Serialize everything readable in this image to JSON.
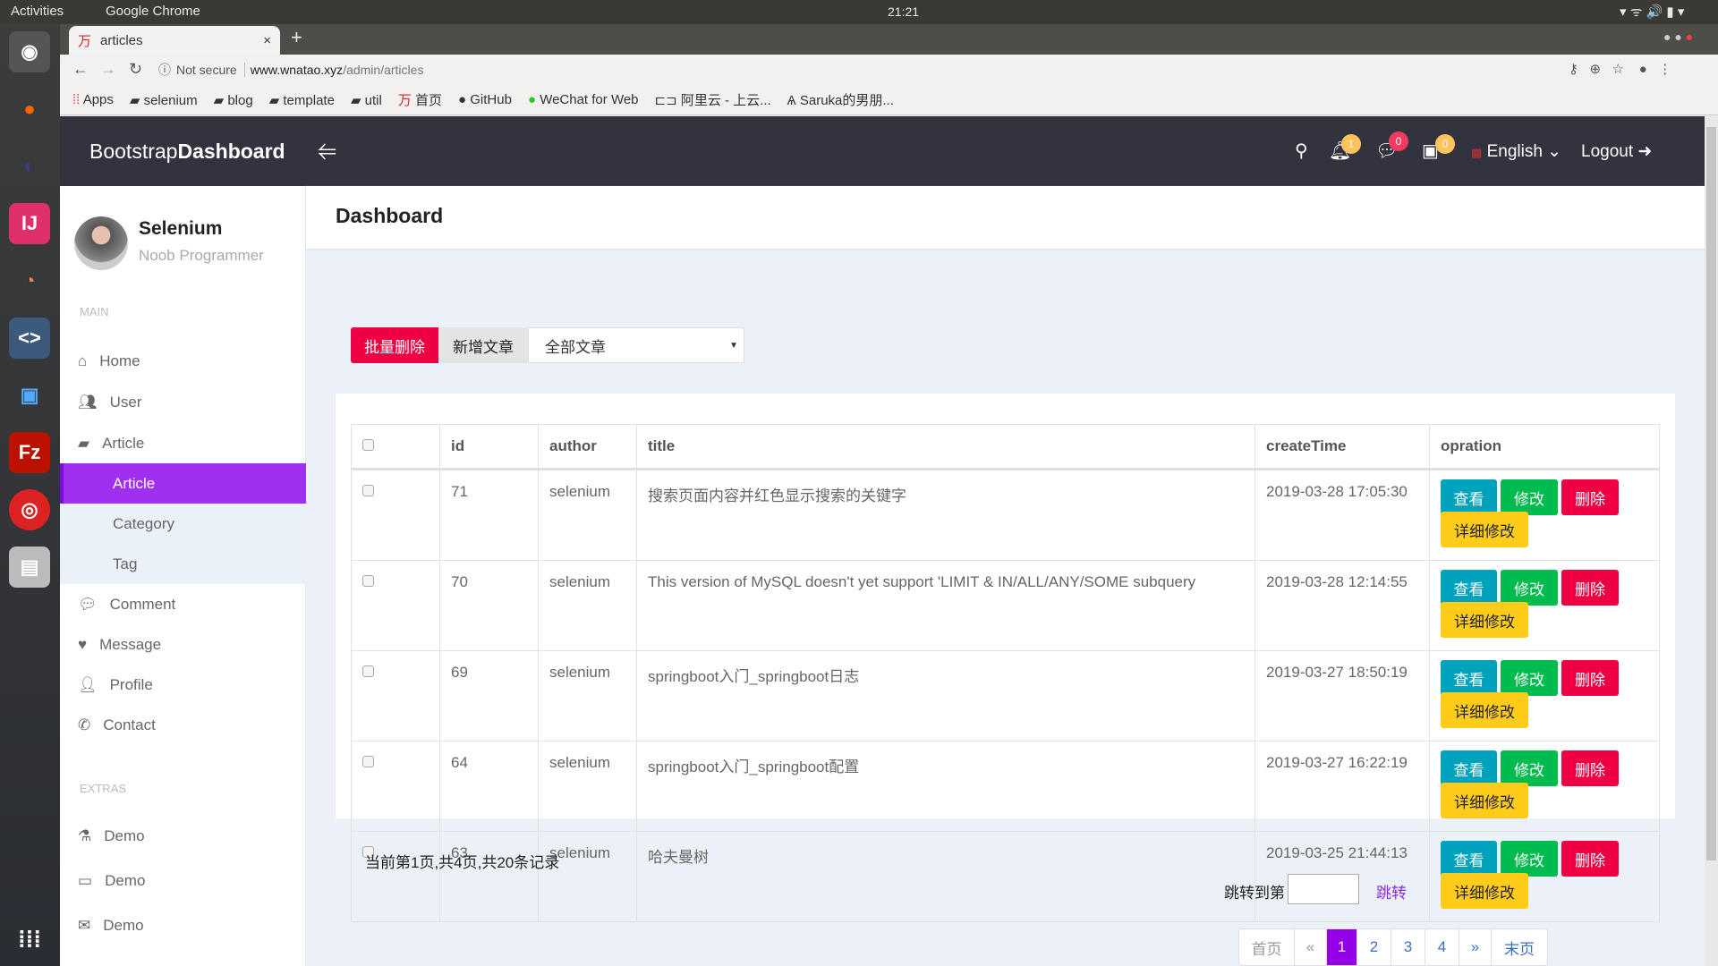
{
  "os": {
    "activities": "Activities",
    "app": "Google Chrome",
    "clock": "21:21"
  },
  "browser": {
    "tab_title": "articles",
    "security": "Not secure",
    "url_host": "www.wnatao.xyz",
    "url_path": "/admin/articles",
    "bookmarks": [
      "Apps",
      "selenium",
      "blog",
      "template",
      "util",
      "首页",
      "GitHub",
      "WeChat for Web",
      "阿里云 - 上云...",
      "Saruka的男朋..."
    ]
  },
  "header": {
    "brand_light": "Bootstrap",
    "brand_bold": "Dashboard",
    "notifications": "1",
    "messages": "0",
    "tasks": "0",
    "language": "English",
    "logout": "Logout"
  },
  "user": {
    "name": "Selenium",
    "role": "Noob Programmer"
  },
  "sidebar": {
    "main_heading": "MAIN",
    "extras_heading": "EXTRAS",
    "items": [
      {
        "label": "Home"
      },
      {
        "label": "User"
      },
      {
        "label": "Article"
      },
      {
        "label": "Article"
      },
      {
        "label": "Category"
      },
      {
        "label": "Tag"
      },
      {
        "label": "Comment"
      },
      {
        "label": "Message"
      },
      {
        "label": "Profile"
      },
      {
        "label": "Contact"
      }
    ],
    "extras": [
      {
        "label": "Demo"
      },
      {
        "label": "Demo"
      },
      {
        "label": "Demo"
      }
    ]
  },
  "page": {
    "title": "Dashboard"
  },
  "toolbar": {
    "batch_delete": "批量删除",
    "new_article": "新增文章",
    "filter_value": "全部文章"
  },
  "table": {
    "headers": [
      "id",
      "author",
      "title",
      "createTime",
      "opration"
    ],
    "rows": [
      {
        "id": "71",
        "author": "selenium",
        "title": "搜索页面内容并红色显示搜索的关键字",
        "time": "2019-03-28 17:05:30"
      },
      {
        "id": "70",
        "author": "selenium",
        "title": "This version of MySQL doesn't yet support 'LIMIT & IN/ALL/ANY/SOME subquery",
        "time": "2019-03-28 12:14:55"
      },
      {
        "id": "69",
        "author": "selenium",
        "title": "springboot入门_springboot日志",
        "time": "2019-03-27 18:50:19"
      },
      {
        "id": "64",
        "author": "selenium",
        "title": "springboot入门_springboot配置",
        "time": "2019-03-27 16:22:19"
      },
      {
        "id": "63",
        "author": "selenium",
        "title": "哈夫曼树",
        "time": "2019-03-25 21:44:13"
      }
    ],
    "actions": {
      "view": "查看",
      "edit": "修改",
      "delete": "删除",
      "detail_edit": "详细修改"
    }
  },
  "pagination": {
    "summary": "当前第1页,共4页,共20条记录",
    "jump_label": "跳转到第",
    "jump_value": "",
    "jump_button": "跳转",
    "first": "首页",
    "prev": "«",
    "pages": [
      "1",
      "2",
      "3",
      "4"
    ],
    "next": "»",
    "last": "末页",
    "current": "1"
  },
  "colors": {
    "accent": "#a030f0",
    "view": "#00a3bb",
    "edit": "#00bb4d",
    "delete": "#ee0043",
    "detail": "#ffcc1a"
  }
}
